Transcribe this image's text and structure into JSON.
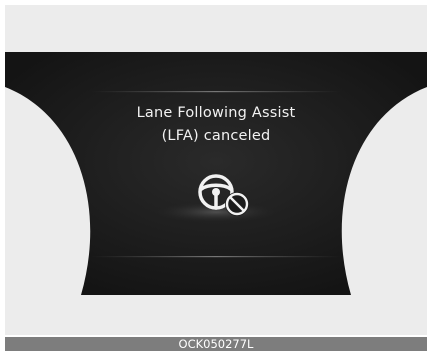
{
  "display": {
    "message_line1": "Lane Following Assist",
    "message_line2": "(LFA) canceled",
    "icon": "steering-wheel-cancel-icon"
  },
  "caption": {
    "code": "OCK050277L"
  },
  "colors": {
    "panel_background": "#1a1a1a",
    "text": "#f2f2f2",
    "outer_background": "#ececec",
    "caption_bar": "#7d7d7d"
  }
}
